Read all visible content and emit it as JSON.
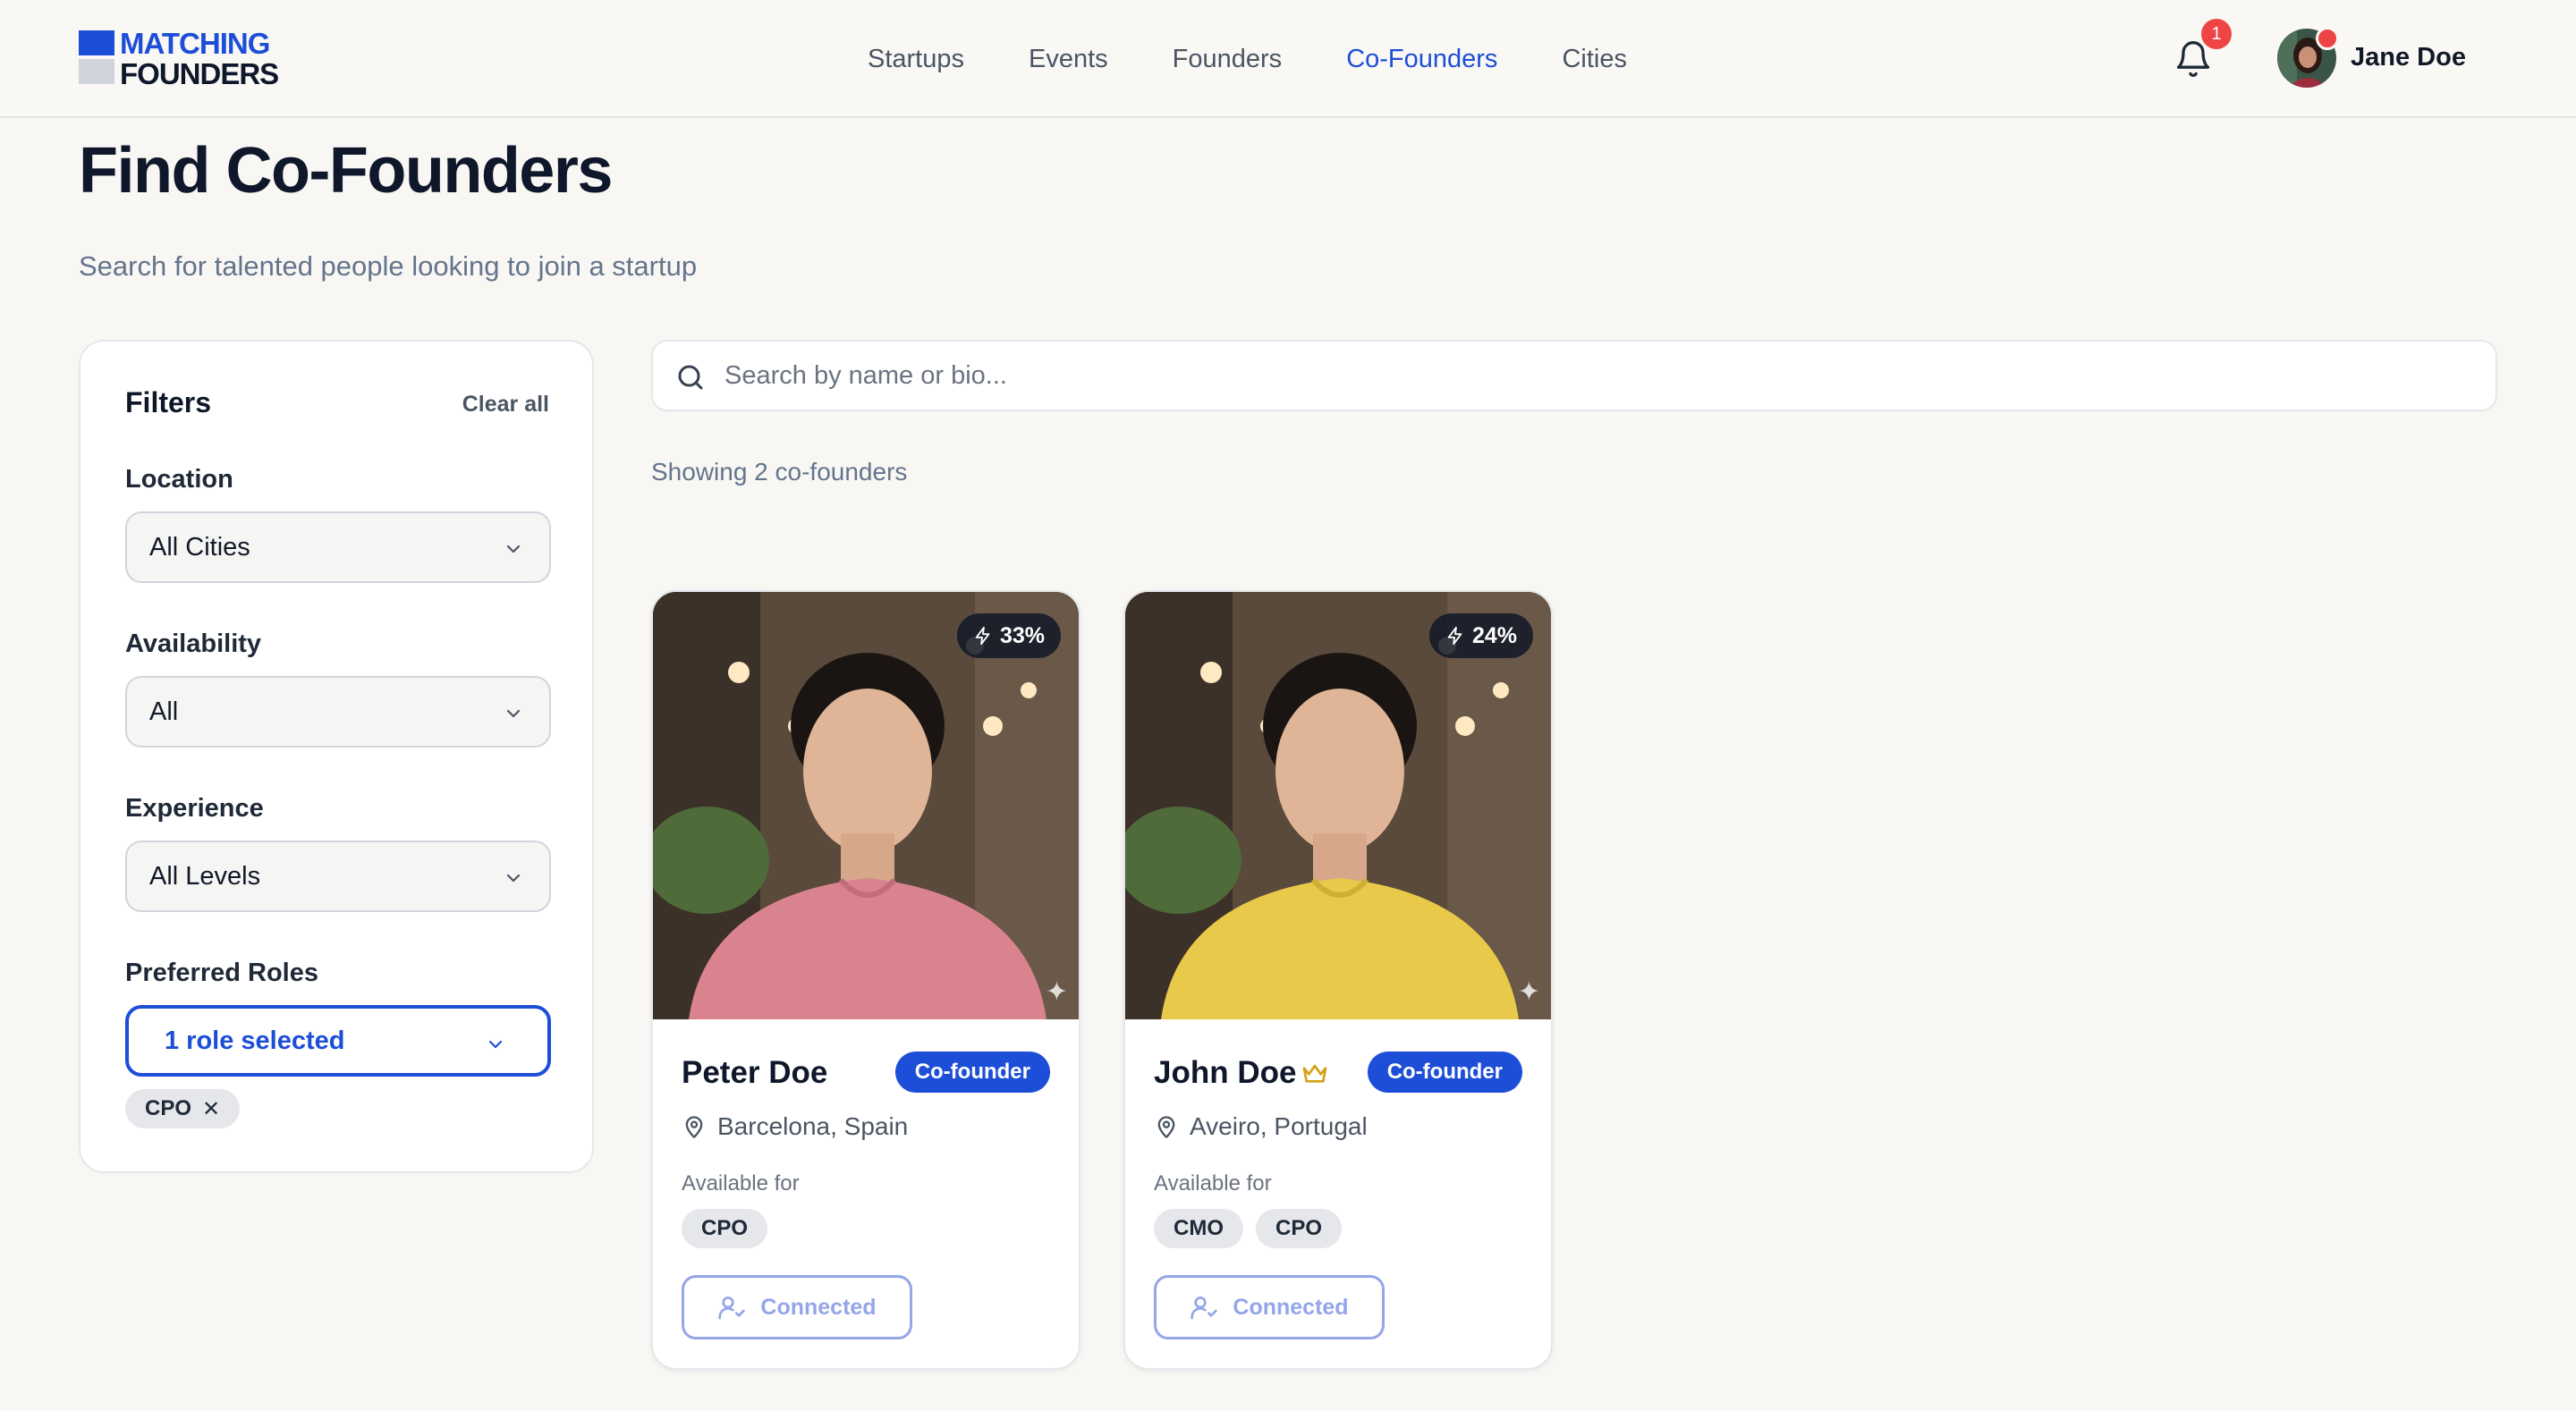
{
  "logo": {
    "line1": "MATCHING",
    "line2": "FOUNDERS"
  },
  "nav": [
    "Startups",
    "Events",
    "Founders",
    "Co-Founders",
    "Cities"
  ],
  "nav_active": "Co-Founders",
  "notifications": {
    "count": "1",
    "icon": "bell-icon"
  },
  "user": {
    "name": "Jane Doe"
  },
  "page": {
    "title": "Find Co-Founders",
    "subtitle": "Search for talented people looking to join a startup"
  },
  "filters": {
    "title": "Filters",
    "clear_all": "Clear all",
    "location": {
      "label": "Location",
      "value": "All Cities"
    },
    "availability": {
      "label": "Availability",
      "value": "All"
    },
    "experience": {
      "label": "Experience",
      "value": "All Levels"
    },
    "roles": {
      "label": "Preferred Roles",
      "value": "1 role selected",
      "chips": [
        "CPO"
      ]
    }
  },
  "search": {
    "placeholder": "Search by name or bio..."
  },
  "results": {
    "count_text": "Showing 2 co-founders"
  },
  "cards": [
    {
      "name": "Peter Doe",
      "match": "33%",
      "badge": "Co-founder",
      "location": "Barcelona, Spain",
      "available_label": "Available for",
      "roles": [
        "CPO"
      ],
      "button": "Connected",
      "shirt_color": "#d9838f",
      "premium": false
    },
    {
      "name": "John Doe",
      "match": "24%",
      "badge": "Co-founder",
      "location": "Aveiro, Portugal",
      "available_label": "Available for",
      "roles": [
        "CMO",
        "CPO"
      ],
      "button": "Connected",
      "shirt_color": "#e8c94a",
      "premium": true
    }
  ],
  "colors": {
    "accent": "#1d4ed8",
    "notification": "#ef4444",
    "background": "#f8f7f4"
  }
}
